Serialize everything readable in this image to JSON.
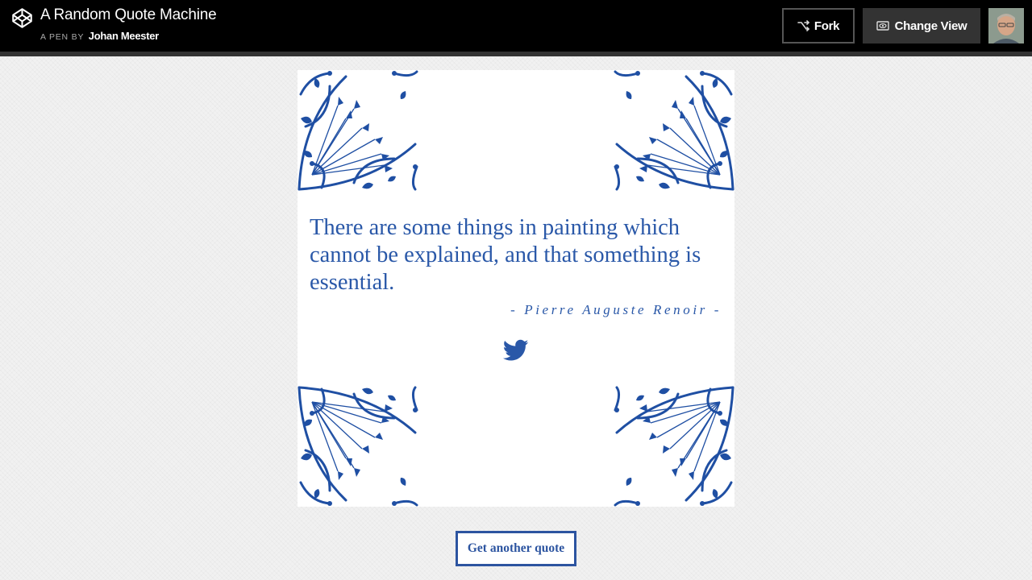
{
  "header": {
    "title": "A Random Quote Machine",
    "pen_by": "A PEN BY",
    "author": "Johan Meester",
    "logo_icon": "codepen-logo-icon",
    "fork_label": "Fork",
    "fork_icon": "fork-icon",
    "change_view_label": "Change View",
    "change_view_icon": "eye-icon",
    "avatar_icon": "user-avatar"
  },
  "quote": {
    "text": "There are some things in painting which cannot be explained, and that something is essential.",
    "author": "- Pierre Auguste Renoir -",
    "tweet_icon": "twitter-icon"
  },
  "actions": {
    "new_quote_label": "Get another quote"
  },
  "colors": {
    "accent": "#2a58a8",
    "button_border": "#2c54a0",
    "header_bg": "#000000",
    "header_border": "#333333",
    "page_bg": "#f1f1f1"
  }
}
